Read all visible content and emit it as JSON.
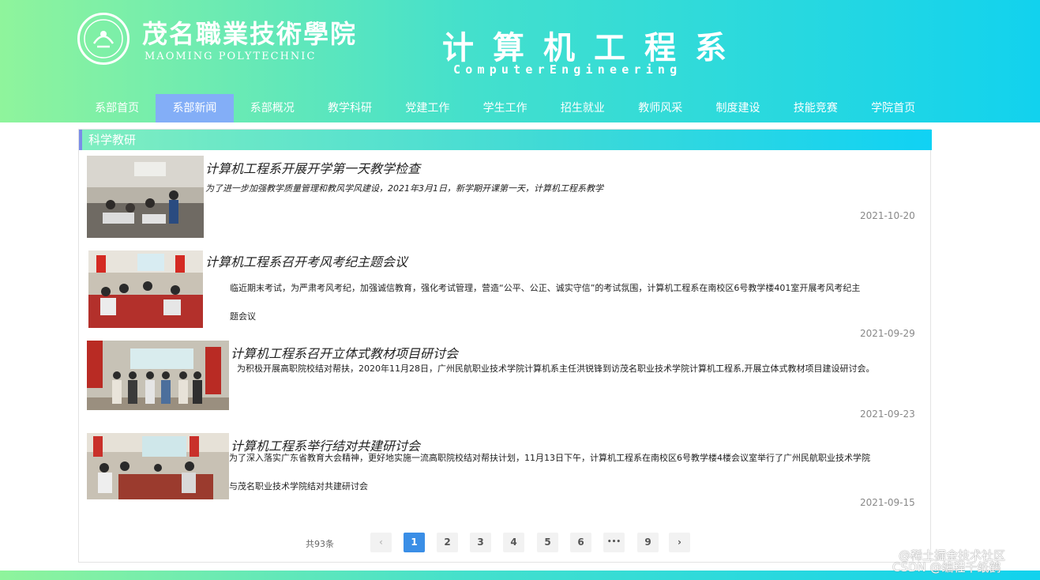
{
  "header": {
    "school_name": "茂名職業技術學院",
    "school_en": "MAOMING POLYTECHNIC",
    "dept_title": "计算机工程系",
    "dept_en": "ComputerEngineering"
  },
  "nav": {
    "items": [
      {
        "label": "系部首页",
        "active": false
      },
      {
        "label": "系部新闻",
        "active": true
      },
      {
        "label": "系部概况",
        "active": false
      },
      {
        "label": "教学科研",
        "active": false
      },
      {
        "label": "党建工作",
        "active": false
      },
      {
        "label": "学生工作",
        "active": false
      },
      {
        "label": "招生就业",
        "active": false
      },
      {
        "label": "教师风采",
        "active": false
      },
      {
        "label": "制度建设",
        "active": false
      },
      {
        "label": "技能竞赛",
        "active": false
      },
      {
        "label": "学院首页",
        "active": false
      }
    ]
  },
  "section": {
    "title": "科学教研"
  },
  "news": [
    {
      "title": "计算机工程系开展开学第一天教学检查",
      "summary_1": "为了进一步加强教学质量管理和教风学风建设，2021年3月1日，新学期开课第一天，计算机工程系教学",
      "summary_2": "",
      "date": "2021-10-20"
    },
    {
      "title": "计算机工程系召开考风考纪主题会议",
      "summary_1": "临近期末考试，为严肃考风考纪，加强诚信教育，强化考试管理，营造“公平、公正、诚实守信”的考试氛围，计算机工程系在南校区6号教学楼401室开展考风考纪主",
      "summary_2": "题会议",
      "date": "2021-09-29"
    },
    {
      "title": "计算机工程系召开立体式教材项目研讨会",
      "summary_1": "为积极开展高职院校结对帮扶，2020年11月28日，广州民航职业技术学院计算机系主任洪锐锋到访茂名职业技术学院计算机工程系,开展立体式教材项目建设研讨会。",
      "summary_2": "",
      "date": "2021-09-23"
    },
    {
      "title": "计算机工程系举行结对共建研讨会",
      "summary_1": "为了深入落实广东省教育大会精神，更好地实施一流高职院校结对帮扶计划，11月13日下午，计算机工程系在南校区6号教学楼4楼会议室举行了广州民航职业技术学院",
      "summary_2": "与茂名职业技术学院结对共建研讨会",
      "date": "2021-09-15"
    }
  ],
  "pagination": {
    "total_label": "共93条",
    "prev": "‹",
    "next": "›",
    "pages": [
      "1",
      "2",
      "3",
      "4",
      "5",
      "6",
      "•••",
      "9"
    ],
    "current": "1"
  },
  "watermark": {
    "line1": "@稀土掘金技术社区",
    "line2": "CSDN @编程千纸鹤"
  },
  "colors": {
    "header_start": "#8ff49c",
    "header_end": "#12d2ee",
    "nav_active": "#83aef7",
    "page_current": "#3a8ee6"
  }
}
